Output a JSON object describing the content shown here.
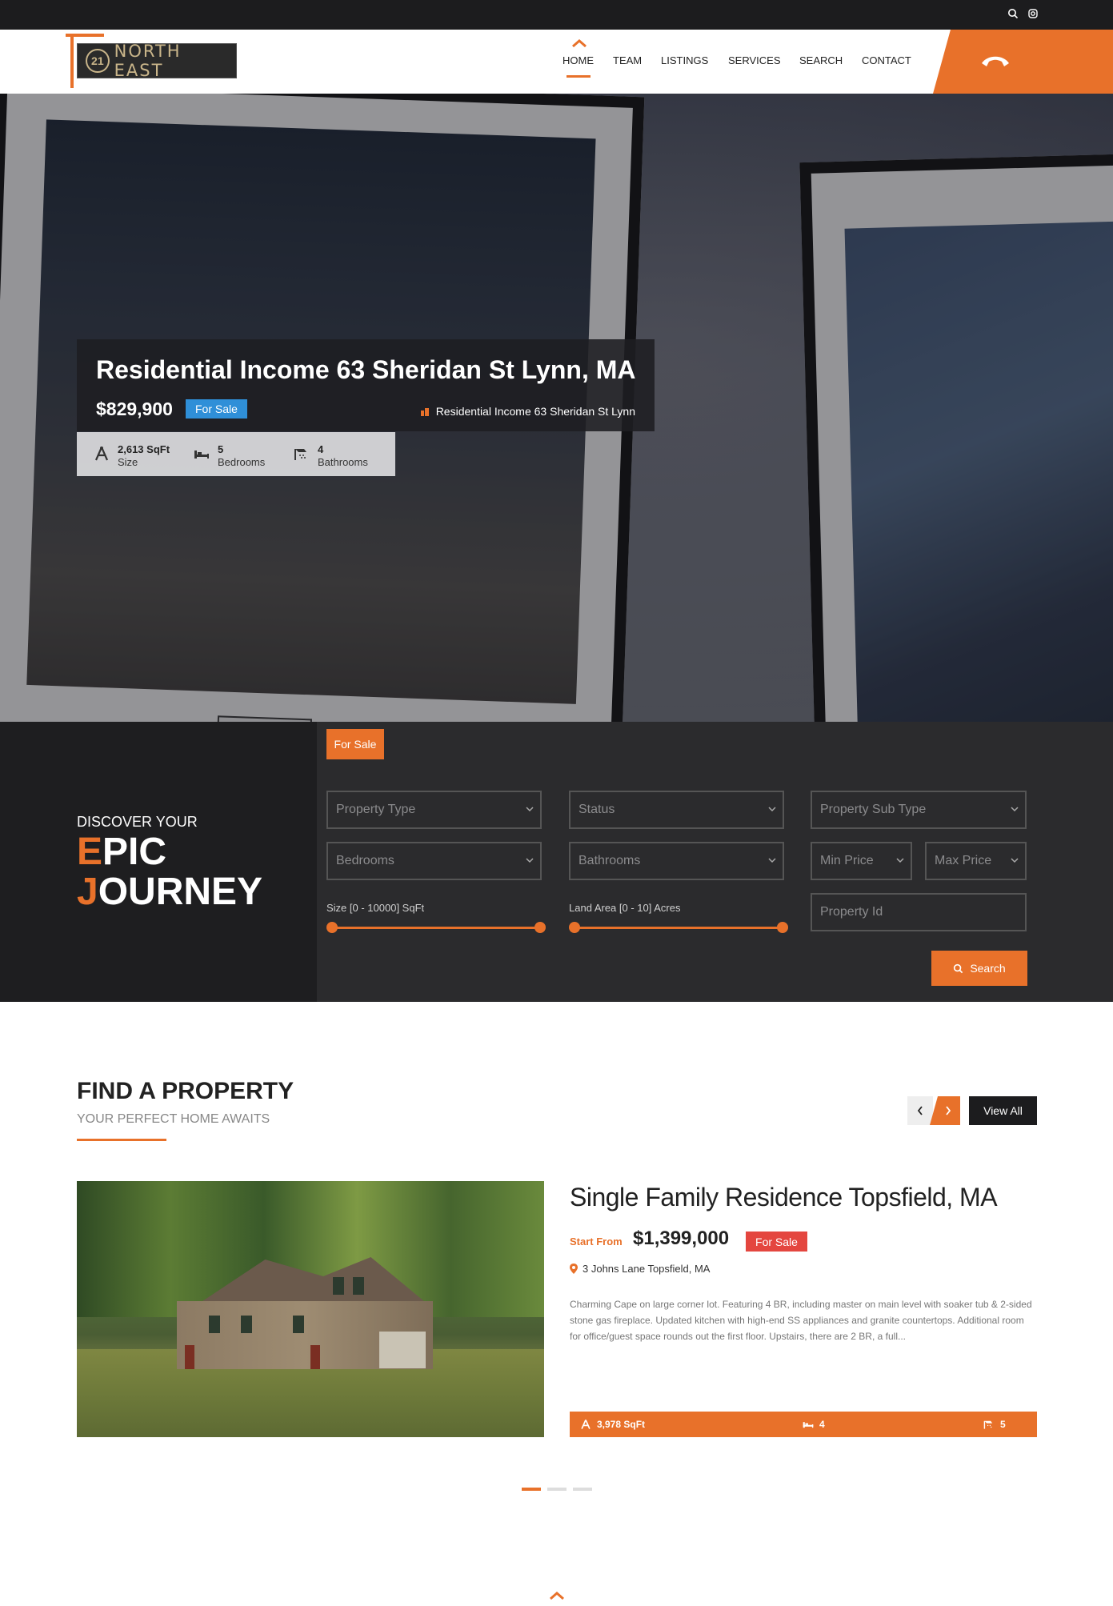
{
  "brand": {
    "logo_mark": "21",
    "logo_text": "NORTH EAST",
    "accent_color": "#e8712a"
  },
  "topbar": {
    "icons": [
      "search-icon",
      "instagram-icon"
    ]
  },
  "nav": {
    "items": [
      "HOME",
      "TEAM",
      "LISTINGS",
      "SERVICES",
      "SEARCH",
      "CONTACT"
    ],
    "active": "HOME",
    "phone_icon": "phone-icon"
  },
  "hero": {
    "title": "Residential Income 63 Sheridan St Lynn, MA",
    "price": "$829,900",
    "badge": "For Sale",
    "address": "Residential Income 63 Sheridan St Lynn",
    "stats": [
      {
        "icon": "size-icon",
        "value": "2,613 SqFt",
        "label": "Size"
      },
      {
        "icon": "bed-icon",
        "value": "5",
        "label": "Bedrooms"
      },
      {
        "icon": "bath-icon",
        "value": "4",
        "label": "Bathrooms"
      }
    ]
  },
  "search": {
    "discover": "DISCOVER YOUR",
    "epic_first": "E",
    "epic_rest": "PIC",
    "journey_first": "J",
    "journey_rest": "OURNEY",
    "tab": "For Sale",
    "property_type": "Property Type",
    "status": "Status",
    "property_sub_type": "Property Sub Type",
    "bedrooms": "Bedrooms",
    "bathrooms": "Bathrooms",
    "min_price": "Min Price",
    "max_price": "Max Price",
    "property_id": "Property Id",
    "size_label": "Size [0 - 10000] SqFt",
    "land_label": "Land Area [0 - 10] Acres",
    "button": "Search"
  },
  "find": {
    "title": "FIND A PROPERTY",
    "subtitle": "YOUR PERFECT HOME AWAITS",
    "view_all": "View All"
  },
  "property": {
    "title": "Single Family Residence Topsfield, MA",
    "start_from": "Start From",
    "price": "$1,399,000",
    "badge": "For Sale",
    "address": "3 Johns Lane Topsfield, MA",
    "description": "Charming Cape on large corner lot. Featuring 4 BR, including master on main level with soaker tub & 2-sided stone gas fireplace. Updated kitchen with high-end SS appliances and granite countertops. Additional room for office/guest space rounds out the first floor. Upstairs, there are 2 BR, a full...",
    "size": "3,978 SqFt",
    "beds": "4",
    "baths": "5"
  },
  "carousel": {
    "active_index": 0,
    "count": 3
  }
}
